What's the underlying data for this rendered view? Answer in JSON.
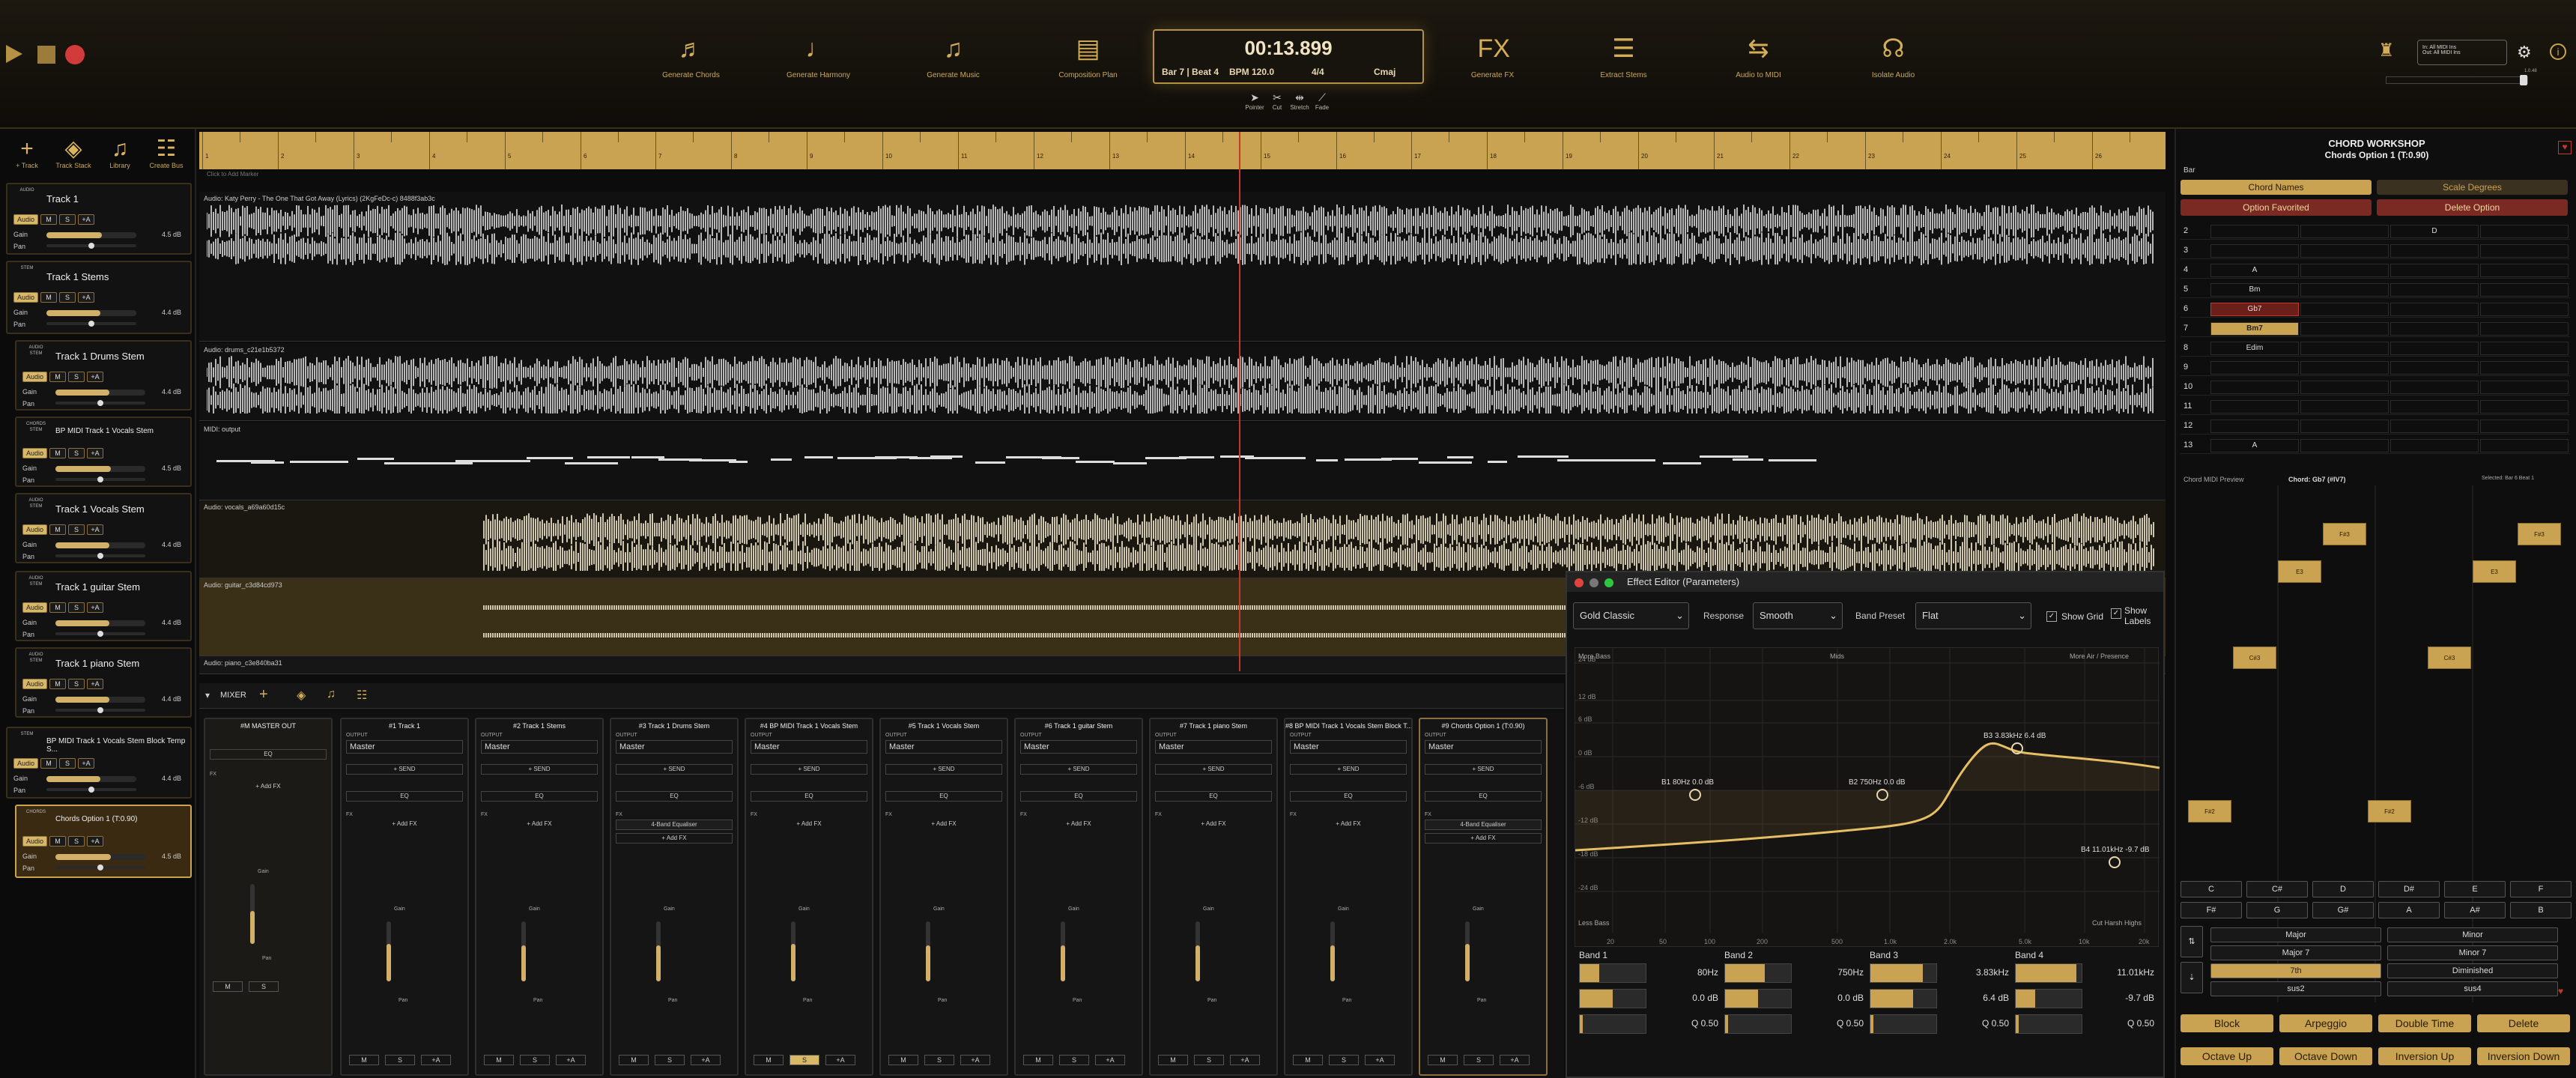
{
  "top": {
    "tools": [
      {
        "label": "Generate Chords",
        "icon": "chords-icon"
      },
      {
        "label": "Generate Harmony",
        "icon": "harmony-icon"
      },
      {
        "label": "Generate Music",
        "icon": "music-icon"
      },
      {
        "label": "Composition Plan",
        "icon": "plan-icon"
      },
      {
        "label": "Generate FX",
        "icon": "fx-icon"
      },
      {
        "label": "Extract Stems",
        "icon": "stems-icon"
      },
      {
        "label": "Audio to MIDI",
        "icon": "midi-icon"
      },
      {
        "label": "Isolate Audio",
        "icon": "headphones-icon"
      }
    ],
    "time": "00:13.899",
    "bar": "Bar 7 | Beat 4",
    "bpm": "BPM 120.0",
    "sig": "4/4",
    "key": "Cmaj",
    "cursor_tools": [
      "Pointer",
      "Cut",
      "Stretch",
      "Fade"
    ],
    "midi_in": "In: All MIDI Ins",
    "midi_out": "Out: All MIDI Ins",
    "ver": "1.0.48"
  },
  "left": {
    "buttons": [
      "+ Track",
      "Track Stack",
      "Library",
      "Create Bus"
    ],
    "tracks": [
      {
        "name": "Track 1",
        "type": "AUDIO",
        "gain": "4.5 dB",
        "gainf": 0.62
      },
      {
        "name": "Track 1 Stems",
        "type": "STEM",
        "gain": "4.4 dB",
        "gainf": 0.6
      },
      {
        "name": "Track 1 Drums Stem",
        "type": "AUDIO STEM",
        "gain": "4.4 dB",
        "gainf": 0.6
      },
      {
        "name": "BP MIDI Track 1 Vocals Stem",
        "type": "CHORDS STEM",
        "gain": "4.5 dB",
        "gainf": 0.62
      },
      {
        "name": "Track 1 Vocals Stem",
        "type": "AUDIO STEM",
        "gain": "4.4 dB",
        "gainf": 0.6
      },
      {
        "name": "Track 1 guitar Stem",
        "type": "AUDIO STEM",
        "gain": "4.4 dB",
        "gainf": 0.6
      },
      {
        "name": "Track 1 piano Stem",
        "type": "AUDIO STEM",
        "gain": "4.4 dB",
        "gainf": 0.6
      },
      {
        "name": "BP MIDI Track 1 Vocals Stem Block Temp S...",
        "type": "STEM",
        "gain": "4.4 dB",
        "gainf": 0.6
      },
      {
        "name": "Chords Option 1 (T:0.90)",
        "type": "CHORDS",
        "gain": "4.5 dB",
        "gainf": 0.62
      }
    ],
    "labels": {
      "audio": "Audio",
      "gain": "Gain",
      "pan": "Pan",
      "m": "M",
      "s": "S",
      "a": "+A"
    }
  },
  "timeline": {
    "bars": [
      "1",
      "2",
      "3",
      "4",
      "5",
      "6",
      "7",
      "8",
      "9",
      "10",
      "11",
      "12",
      "13",
      "14",
      "15",
      "16",
      "17",
      "18",
      "19",
      "20",
      "21",
      "22",
      "23",
      "24",
      "25",
      "26"
    ],
    "click": "Click to Add Marker"
  },
  "lanes": [
    "Audio: Katy Perry - The One That Got Away (Lyrics) (2KgFeDc-c) 8488f3ab3c",
    "Audio: drums_c21e1b5372",
    "MIDI: output",
    "Audio: vocals_a69a60d15c",
    "Audio: guitar_c3d84cd973",
    "Audio: piano_c3e840ba31"
  ],
  "mixer": {
    "title": "MIXER",
    "strips": [
      {
        "name": "#M  MASTER OUT",
        "out": "",
        "fx": "",
        "ff": 0.55
      },
      {
        "name": "#1  Track 1",
        "out": "Master",
        "fx": "",
        "ff": 0.62
      },
      {
        "name": "#2  Track 1 Stems",
        "out": "Master",
        "fx": "",
        "ff": 0.6
      },
      {
        "name": "#3  Track 1 Drums Stem",
        "out": "Master",
        "fx": "4-Band Equaliser",
        "ff": 0.6
      },
      {
        "name": "#4  BP MIDI Track 1 Vocals Stem",
        "out": "Master",
        "fx": "",
        "ff": 0.62
      },
      {
        "name": "#5  Track 1 Vocals Stem",
        "out": "Master",
        "fx": "",
        "ff": 0.6
      },
      {
        "name": "#6  Track 1 guitar Stem",
        "out": "Master",
        "fx": "",
        "ff": 0.6
      },
      {
        "name": "#7  Track 1 piano Stem",
        "out": "Master",
        "fx": "",
        "ff": 0.6
      },
      {
        "name": "#8  BP MIDI Track 1 Vocals Stem Block T...",
        "out": "Master",
        "fx": "",
        "ff": 0.6
      },
      {
        "name": "#9  Chords Option 1 (T:0.90)",
        "out": "Master",
        "fx": "4-Band Equaliser",
        "ff": 0.62
      }
    ],
    "labels": {
      "output": "OUTPUT",
      "send": "+ SEND",
      "eq": "EQ",
      "fxlab": "FX",
      "addfx": "+ Add FX",
      "gain": "Gain",
      "pan": "Pan"
    }
  },
  "fx": {
    "title": "Effect Editor (Parameters)",
    "preset": "Gold Classic",
    "response_l": "Response",
    "response": "Smooth",
    "band_l": "Band Preset",
    "band": "Flat",
    "grid": "Show Grid",
    "labels": "Show Labels",
    "graph_top": [
      "More Bass",
      "Mids",
      "More Air / Presence"
    ],
    "graph_bottom": [
      "Less Bass",
      "Cut Harsh Highs"
    ],
    "ylabels": [
      "24 dB",
      "12 dB",
      "6 dB",
      "0 dB",
      "-6 dB",
      "-12 dB",
      "-18 dB",
      "-24 dB"
    ],
    "xlabels": [
      "20",
      "50",
      "100",
      "200",
      "500",
      "1.0k",
      "2.0k",
      "5.0k",
      "10k",
      "20k"
    ],
    "points": [
      "B1 80Hz  0.0 dB",
      "B2 750Hz  0.0 dB",
      "B3 3.83kHz  6.4 dB",
      "B4 11.01kHz  -9.7 dB"
    ],
    "bands": [
      {
        "name": "Band 1",
        "freq": "80Hz",
        "gain": "0.0 dB",
        "q": "Q 0.50",
        "ff": 0.3,
        "gf": 0.5,
        "qf": 0.05
      },
      {
        "name": "Band 2",
        "freq": "750Hz",
        "gain": "0.0 dB",
        "q": "Q 0.50",
        "ff": 0.6,
        "gf": 0.5,
        "qf": 0.05
      },
      {
        "name": "Band 3",
        "freq": "3.83kHz",
        "gain": "6.4 dB",
        "q": "Q 0.50",
        "ff": 0.8,
        "gf": 0.65,
        "qf": 0.05
      },
      {
        "name": "Band 4",
        "freq": "11.01kHz",
        "gain": "-9.7 dB",
        "q": "Q 0.50",
        "ff": 0.92,
        "gf": 0.3,
        "qf": 0.05
      }
    ]
  },
  "right": {
    "title": "CHORD WORKSHOP",
    "subtitle": "Chords Option 1 (T:0.90)",
    "bar": "Bar",
    "tab1": "Chord Names",
    "tab2": "Scale Degrees",
    "fav": "Option Favorited",
    "del": "Delete Option",
    "rows": [
      {
        "n": "2",
        "c": [
          "",
          "",
          "D",
          ""
        ]
      },
      {
        "n": "3",
        "c": [
          "",
          "",
          "",
          ""
        ]
      },
      {
        "n": "4",
        "c": [
          "A",
          "",
          "",
          ""
        ]
      },
      {
        "n": "5",
        "c": [
          "Bm",
          "",
          "",
          ""
        ]
      },
      {
        "n": "6",
        "c": [
          "Gb7",
          "",
          "",
          ""
        ]
      },
      {
        "n": "7",
        "c": [
          "Bm7",
          "",
          "",
          ""
        ]
      },
      {
        "n": "8",
        "c": [
          "Edim",
          "",
          "",
          ""
        ]
      },
      {
        "n": "9",
        "c": [
          "",
          "",
          "",
          ""
        ]
      },
      {
        "n": "10",
        "c": [
          "",
          "",
          "",
          ""
        ]
      },
      {
        "n": "11",
        "c": [
          "",
          "",
          "",
          ""
        ]
      },
      {
        "n": "12",
        "c": [
          "",
          "",
          "",
          ""
        ]
      },
      {
        "n": "13",
        "c": [
          "A",
          "",
          "",
          ""
        ]
      }
    ],
    "preview": "Chord MIDI Preview",
    "chord": "Chord: Gb7 (#IV7)",
    "selected": "Selected: Bar 6 Beat 1",
    "notes": [
      "F#3",
      "E3",
      "C#3",
      "F#2",
      "F#3",
      "E3",
      "C#3",
      "F#2"
    ],
    "keys": [
      "C",
      "C#",
      "D",
      "D#",
      "E",
      "F",
      "F#",
      "G",
      "G#",
      "A",
      "A#",
      "B"
    ],
    "qual": [
      "Major",
      "Minor",
      "Major 7",
      "Minor 7",
      "7th",
      "Diminished",
      "sus2",
      "sus4"
    ],
    "actions": [
      "Block",
      "Arpeggio",
      "Double Time",
      "Delete"
    ],
    "actions2": [
      "Octave Up",
      "Octave Down",
      "Inversion Up",
      "Inversion Down"
    ]
  }
}
